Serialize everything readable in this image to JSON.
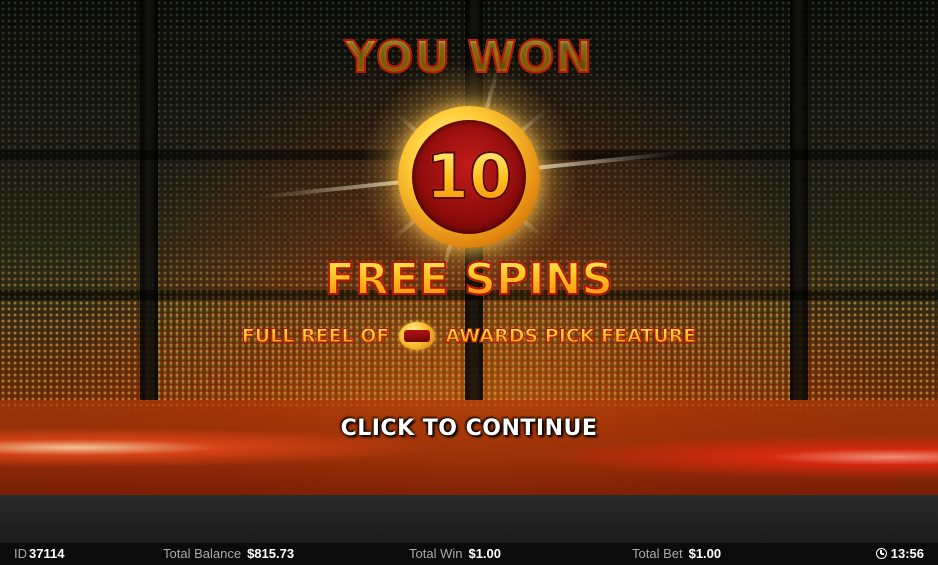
{
  "popup": {
    "headline": "YOU WON",
    "spins_count": "10",
    "prize_label": "FREE SPINS",
    "feature_prefix": "FULL REEL OF",
    "feature_icon": "red-gold-coin-icon",
    "feature_suffix": "AWARDS PICK FEATURE",
    "continue_label": "CLICK TO CONTINUE"
  },
  "status_bar": {
    "id_label": "ID",
    "id_value": "37114",
    "balance_label": "Total Balance",
    "balance_value": "$815.73",
    "win_label": "Total Win",
    "win_value": "$1.00",
    "bet_label": "Total Bet",
    "bet_value": "$1.00",
    "clock_icon": "clock-icon",
    "time": "13:56"
  }
}
